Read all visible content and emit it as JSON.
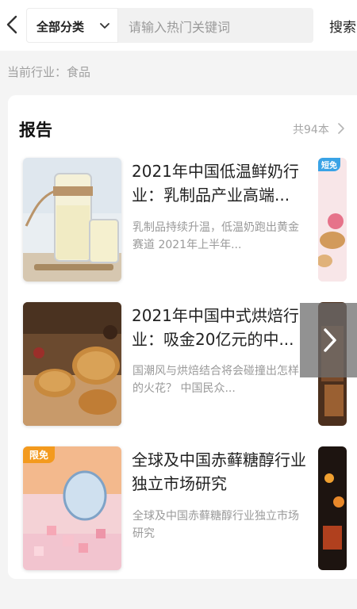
{
  "header": {
    "category_label": "全部分类",
    "search_placeholder": "请输入热门关键词",
    "search_button": "搜索"
  },
  "industry_label": "当前行业：食品",
  "section": {
    "title": "报告",
    "count": "共94本"
  },
  "reports": [
    {
      "title": "2021年中国低温鲜奶行业：乳制品产业高端...",
      "desc": "乳制品持续升温，低温奶跑出黄金赛道 2021年上半年...",
      "badge": ""
    },
    {
      "title": "2021年中国中式烘焙行业：吸金20亿元的中...",
      "desc": "国潮风与烘焙结合将会碰撞出怎样的火花？ 中国民众...",
      "badge": ""
    },
    {
      "title": "全球及中国赤藓糖醇行业独立市场研究",
      "desc": "全球及中国赤藓糖醇行业独立市场研究",
      "badge": "限免"
    }
  ],
  "side_badge": "短免",
  "icons": {
    "back": "chevron-left-icon",
    "dropdown": "chevron-down-icon",
    "more": "chevron-right-icon",
    "next": "chevron-right-icon"
  },
  "colors": {
    "badge": "#f39a1e",
    "side_badge": "#3aa3e6"
  }
}
